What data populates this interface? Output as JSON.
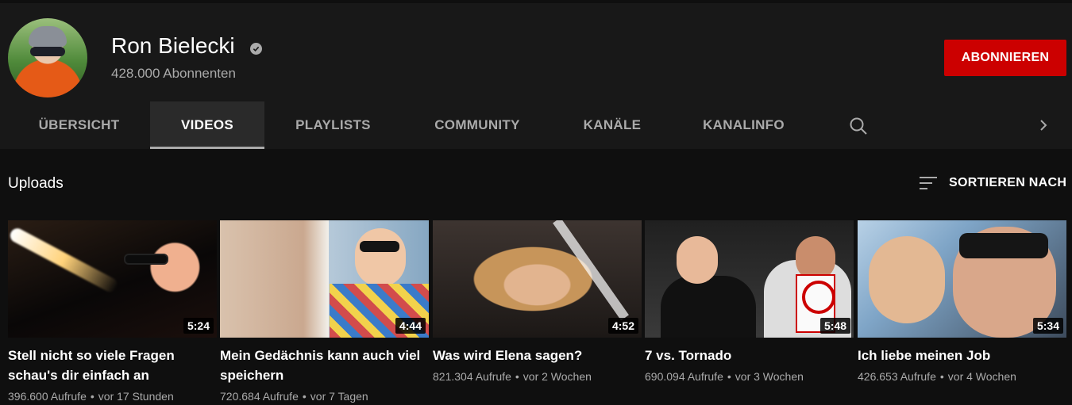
{
  "channel": {
    "name": "Ron Bielecki",
    "subscribers": "428.000 Abonnenten",
    "subscribe_label": "ABONNIEREN"
  },
  "tabs": [
    {
      "label": "ÜBERSICHT",
      "active": false
    },
    {
      "label": "VIDEOS",
      "active": true
    },
    {
      "label": "PLAYLISTS",
      "active": false
    },
    {
      "label": "COMMUNITY",
      "active": false
    },
    {
      "label": "KANÄLE",
      "active": false
    },
    {
      "label": "KANALINFO",
      "active": false
    }
  ],
  "icons": {
    "verified": "verified-check-icon",
    "search": "search-icon",
    "next": "chevron-right-icon",
    "sort": "sort-icon"
  },
  "section": {
    "title": "Uploads",
    "sort_label": "SORTIEREN NACH"
  },
  "videos": [
    {
      "title": "Stell nicht so viele Fragen schau's dir einfach an",
      "duration": "5:24",
      "views": "396.600 Aufrufe",
      "age": "vor 17 Stunden"
    },
    {
      "title": "Mein Gedächnis kann auch viel speichern",
      "duration": "4:44",
      "views": "720.684 Aufrufe",
      "age": "vor 7 Tagen"
    },
    {
      "title": "Was wird Elena sagen?",
      "duration": "4:52",
      "views": "821.304 Aufrufe",
      "age": "vor 2 Wochen"
    },
    {
      "title": "7 vs. Tornado",
      "duration": "5:48",
      "views": "690.094 Aufrufe",
      "age": "vor 3 Wochen"
    },
    {
      "title": "Ich liebe meinen Job",
      "duration": "5:34",
      "views": "426.653 Aufrufe",
      "age": "vor 4 Wochen"
    }
  ],
  "colors": {
    "background": "#181818",
    "content_background": "#0f0f0f",
    "subscribe": "#cc0000",
    "muted_text": "#aaaaaa"
  }
}
